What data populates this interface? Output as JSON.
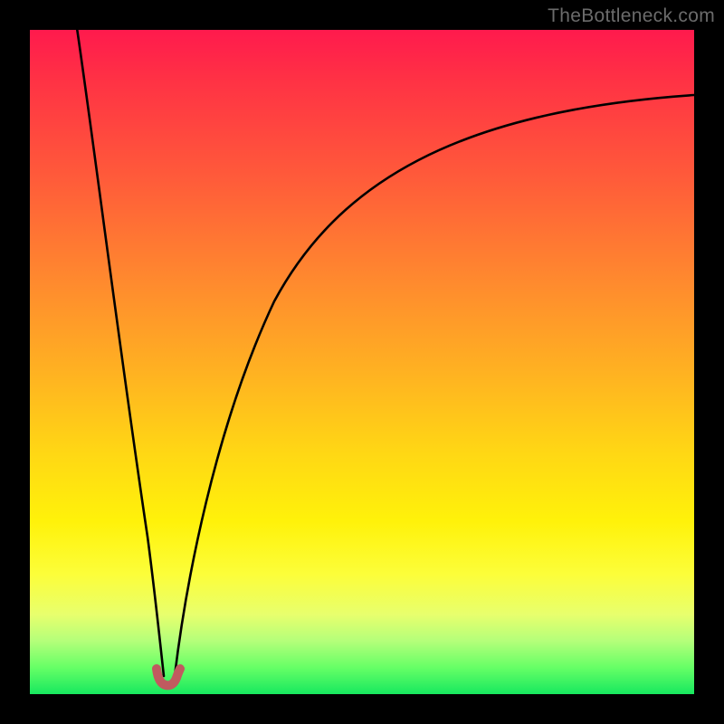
{
  "watermark": "TheBottleneck.com",
  "colors": {
    "frame": "#000000",
    "curve": "#000000",
    "marker": "#c05a5f",
    "gradient_top": "#ff1a4d",
    "gradient_bottom": "#17e85f"
  },
  "chart_data": {
    "type": "line",
    "title": "",
    "xlabel": "",
    "ylabel": "",
    "xlim": [
      0,
      100
    ],
    "ylim": [
      0,
      100
    ],
    "series": [
      {
        "name": "left-branch",
        "x": [
          7,
          8,
          10,
          12,
          14,
          16,
          17,
          18,
          19,
          19.5
        ],
        "y": [
          100,
          88,
          70,
          54,
          40,
          26,
          18,
          10,
          4,
          1
        ]
      },
      {
        "name": "right-branch",
        "x": [
          21,
          22,
          24,
          27,
          31,
          36,
          42,
          50,
          60,
          72,
          86,
          100
        ],
        "y": [
          1,
          6,
          17,
          32,
          45,
          56,
          65,
          73,
          79,
          84,
          88,
          90
        ]
      },
      {
        "name": "bottom-marker",
        "x": [
          18.5,
          19,
          19.5,
          20,
          20.5,
          21,
          21.5
        ],
        "y": [
          2.5,
          1,
          0.5,
          0.5,
          0.5,
          1,
          2.5
        ]
      }
    ],
    "note": "Values are approximate, read off a bottleneck curve with no visible axes. x and y are percentages of the plot area; y=100 is top, y=0 is bottom."
  }
}
